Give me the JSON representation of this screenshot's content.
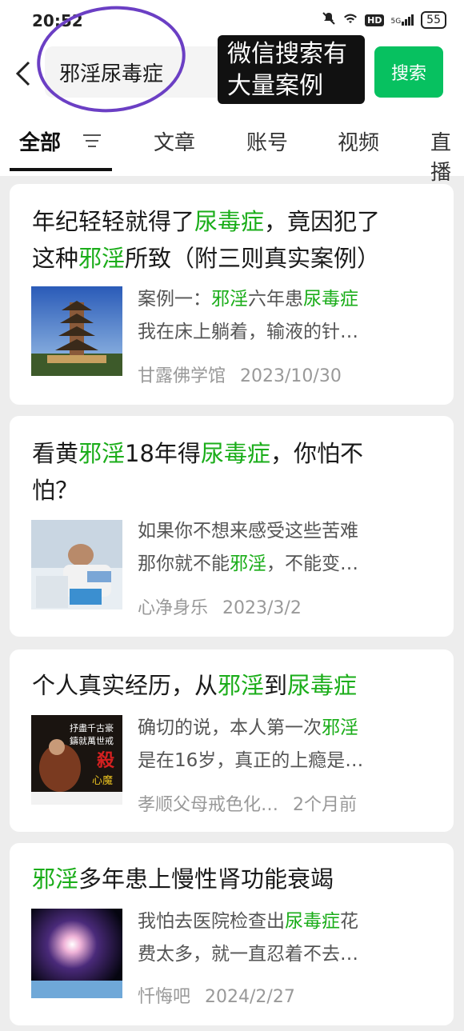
{
  "status_bar": {
    "time": "20:52",
    "battery": "55",
    "network": "5G"
  },
  "search": {
    "query": "邪淫尿毒症",
    "button": "搜索"
  },
  "overlay_caption": [
    "微信搜索有",
    "大量案例"
  ],
  "tabs": [
    {
      "label": "全部",
      "active": true
    },
    {
      "label": "文章"
    },
    {
      "label": "账号"
    },
    {
      "label": "视频"
    },
    {
      "label": "直播"
    }
  ],
  "colors": {
    "accent": "#07c160",
    "highlight": "#1aad19",
    "annotation": "#6b3fc4"
  },
  "results": [
    {
      "title_line1": [
        {
          "t": "年纪轻轻就得了"
        },
        {
          "t": "尿毒症",
          "hl": true
        },
        {
          "t": "，竟因犯了"
        }
      ],
      "title_line2": [
        {
          "t": "这种"
        },
        {
          "t": "邪淫",
          "hl": true
        },
        {
          "t": "所致（附三则真实案例）"
        }
      ],
      "snippet_line1": [
        {
          "t": "案例一："
        },
        {
          "t": "邪淫",
          "hl": true
        },
        {
          "t": "六年患"
        },
        {
          "t": "尿毒症",
          "hl": true
        }
      ],
      "snippet_line2": [
        {
          "t": "我在床上躺着，输液的针…"
        }
      ],
      "source": "甘露佛学馆",
      "date": "2023/10/30",
      "thumb": "pagoda"
    },
    {
      "title_line1": [
        {
          "t": "看黄"
        },
        {
          "t": "邪淫",
          "hl": true
        },
        {
          "t": "18年得"
        },
        {
          "t": "尿毒症",
          "hl": true
        },
        {
          "t": "，你怕不"
        }
      ],
      "title_line2": [
        {
          "t": "怕？"
        }
      ],
      "snippet_line1": [
        {
          "t": "如果你不想来感受这些苦难"
        }
      ],
      "snippet_line2": [
        {
          "t": "那你就不能"
        },
        {
          "t": "邪淫",
          "hl": true
        },
        {
          "t": "，不能变…"
        }
      ],
      "source": "心净身乐",
      "date": "2023/3/2",
      "thumb": "hospital-bed"
    },
    {
      "title_line1": [
        {
          "t": "个人真实经历，从"
        },
        {
          "t": "邪淫",
          "hl": true
        },
        {
          "t": "到"
        },
        {
          "t": "尿毒症",
          "hl": true
        }
      ],
      "title_line2": [],
      "snippet_line1": [
        {
          "t": "确切的说，本人第一次"
        },
        {
          "t": "邪淫",
          "hl": true
        }
      ],
      "snippet_line2": [
        {
          "t": "是在16岁，真正的上瘾是…"
        }
      ],
      "source": "孝顺父母戒色化…",
      "date": "2个月前",
      "thumb": "poster",
      "thumb_text": [
        "抒盡千古豪",
        "鑄就萬世戒",
        "殺",
        "心魔"
      ]
    },
    {
      "title_line1": [
        {
          "t": "邪淫",
          "hl": true
        },
        {
          "t": "多年患上慢性肾功能衰竭"
        }
      ],
      "title_line2": [],
      "snippet_line1": [
        {
          "t": "我怕去医院检查出"
        },
        {
          "t": "尿毒症",
          "hl": true
        },
        {
          "t": "花"
        }
      ],
      "snippet_line2": [
        {
          "t": "费太多，就一直忍着不去…"
        }
      ],
      "source": "忏悔吧",
      "date": "2024/2/27",
      "thumb": "galaxy"
    }
  ]
}
